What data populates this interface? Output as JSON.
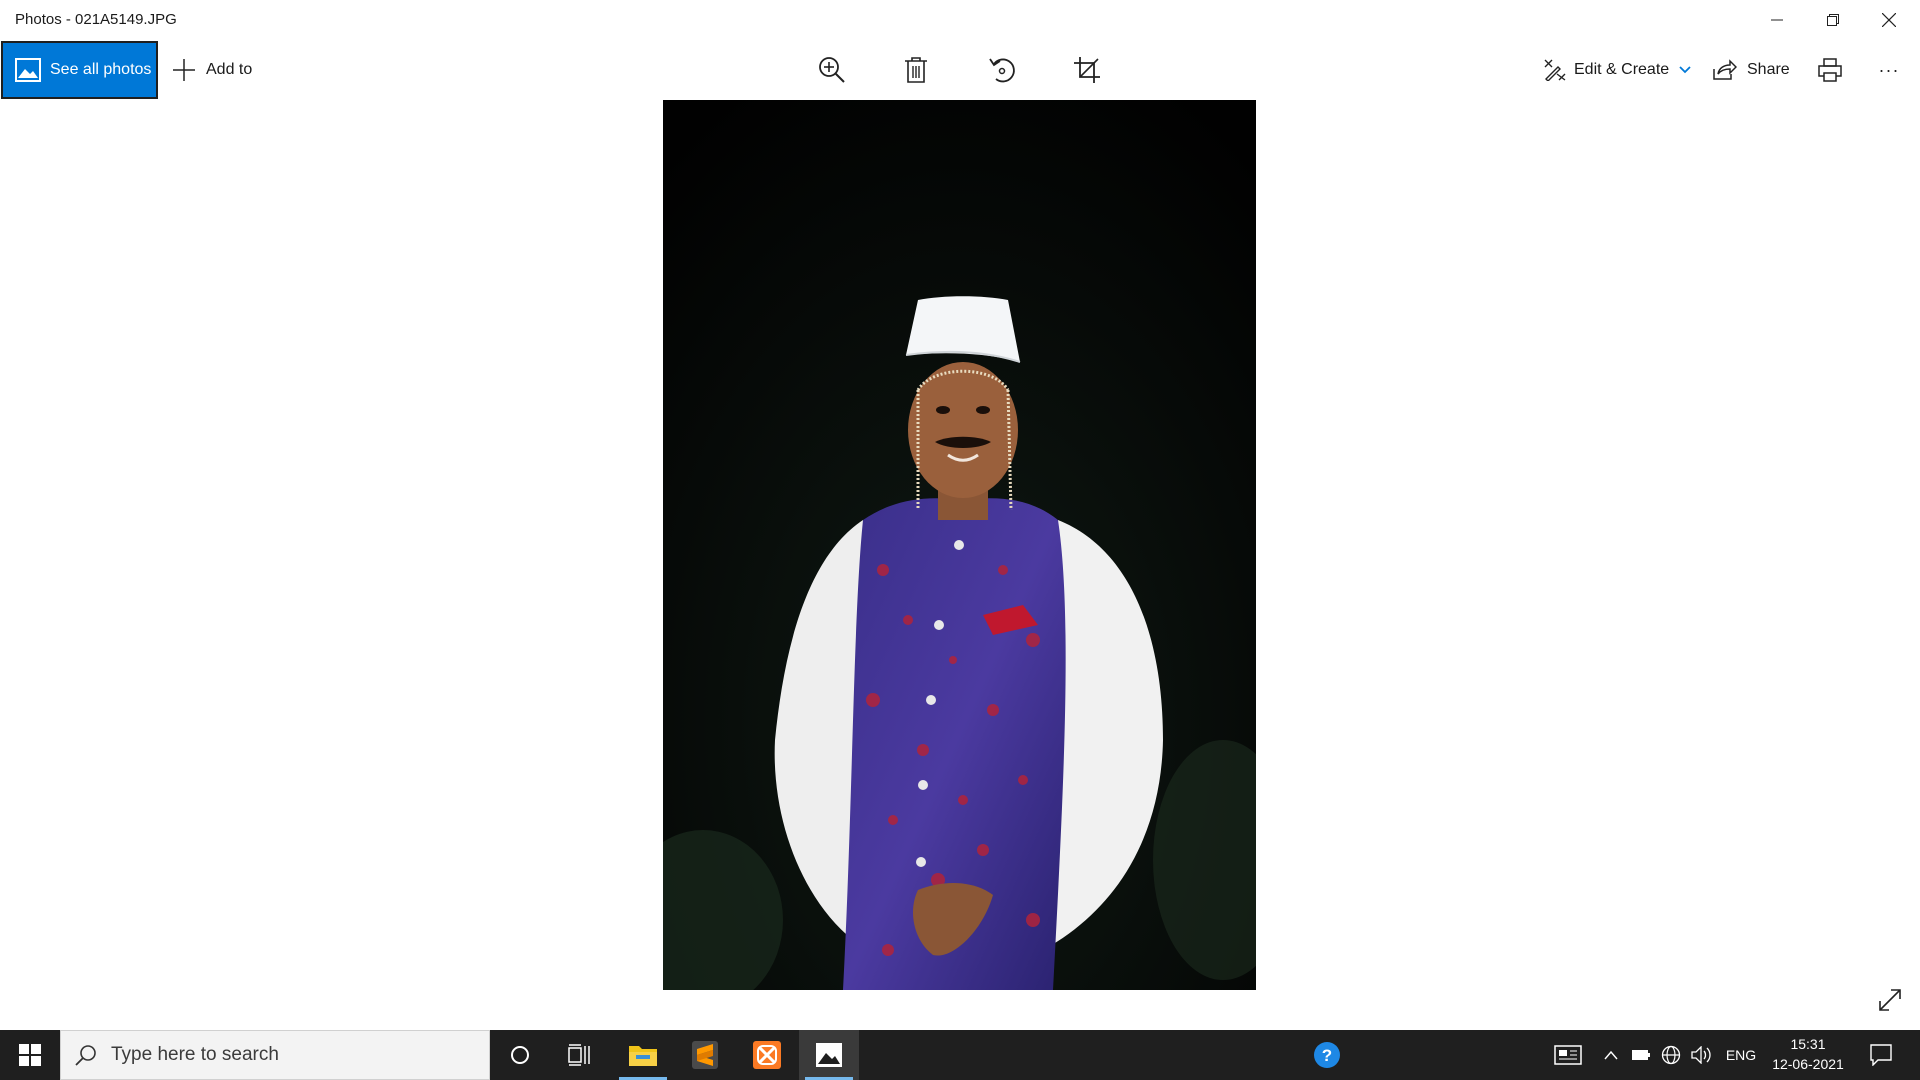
{
  "window": {
    "title": "Photos - 021A5149.JPG"
  },
  "toolbar": {
    "see_all_label": "See all photos",
    "add_to_label": "Add to",
    "edit_create_label": "Edit & Create",
    "share_label": "Share",
    "more_label": "···"
  },
  "photo": {
    "filename": "021A5149.JPG"
  },
  "taskbar": {
    "search_placeholder": "Type here to search",
    "language": "ENG",
    "time": "15:31",
    "date": "12-06-2021"
  },
  "colors": {
    "accent": "#0078d7",
    "taskbar": "#1f1f1f",
    "active_underline": "#76b9ed"
  }
}
